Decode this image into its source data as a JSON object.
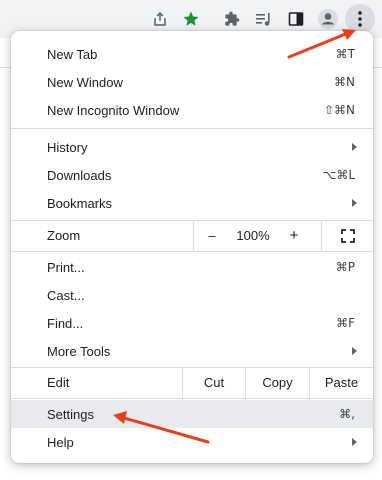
{
  "toolbar": {
    "icons": [
      "share-icon",
      "bookmark-star-icon",
      "extensions-icon",
      "reading-list-icon",
      "side-panel-icon",
      "profile-icon",
      "menu-dots-icon"
    ],
    "accent": "#1e8e3e"
  },
  "menu": {
    "new_tab": {
      "label": "New Tab",
      "shortcut": "⌘T"
    },
    "new_window": {
      "label": "New Window",
      "shortcut": "⌘N"
    },
    "new_incognito": {
      "label": "New Incognito Window",
      "shortcut": "⇧⌘N"
    },
    "history": {
      "label": "History"
    },
    "downloads": {
      "label": "Downloads",
      "shortcut": "⌥⌘L"
    },
    "bookmarks": {
      "label": "Bookmarks"
    },
    "zoom": {
      "label": "Zoom",
      "minus": "–",
      "level": "100%",
      "plus": "+"
    },
    "print": {
      "label": "Print...",
      "shortcut": "⌘P"
    },
    "cast": {
      "label": "Cast..."
    },
    "find": {
      "label": "Find...",
      "shortcut": "⌘F"
    },
    "more_tools": {
      "label": "More Tools"
    },
    "edit": {
      "label": "Edit",
      "cut": "Cut",
      "copy": "Copy",
      "paste": "Paste"
    },
    "settings": {
      "label": "Settings",
      "shortcut": "⌘,"
    },
    "help": {
      "label": "Help"
    }
  },
  "annotation_color": "#e8401c"
}
